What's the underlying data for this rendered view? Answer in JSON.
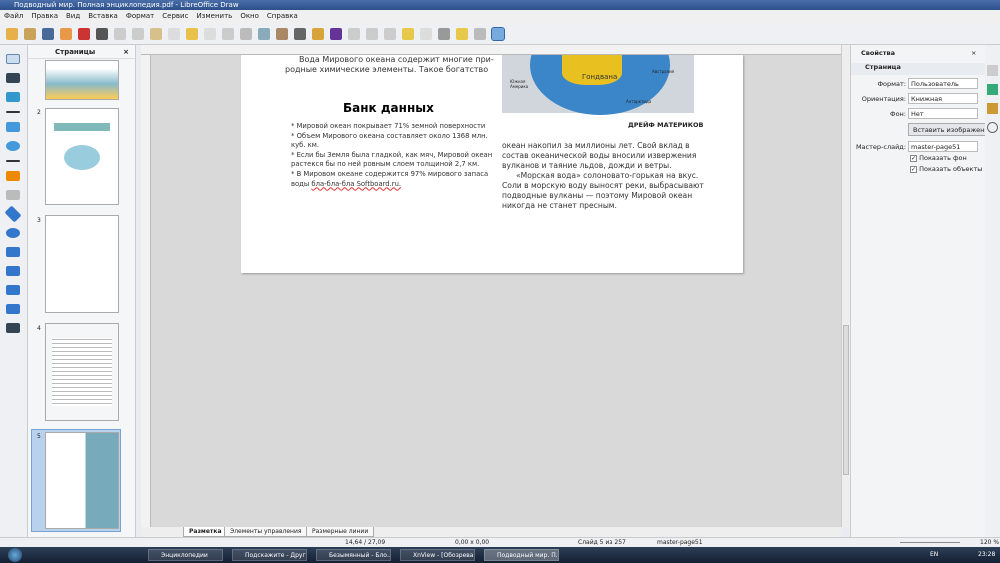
{
  "window": {
    "title": "Подводный мир. Полная энциклопедия.pdf - LibreOffice Draw"
  },
  "menu": [
    "Файл",
    "Правка",
    "Вид",
    "Вставка",
    "Формат",
    "Сервис",
    "Изменить",
    "Окно",
    "Справка"
  ],
  "pages_panel": {
    "title": "Страницы",
    "close": "×",
    "numbers": [
      "2",
      "3",
      "4",
      "5"
    ]
  },
  "page": {
    "top_line1": "Вода Мирового океана содержит многие при-",
    "top_line2": "родные химические элементы. Такое богатство",
    "map_labels": {
      "gondwana": "Гондвана",
      "south_america": "Южная Америка",
      "australia": "Австралия",
      "antarctica": "Антарктида"
    },
    "map_caption": "ДРЕЙФ МАТЕРИКОВ",
    "heading": "Банк данных",
    "bullets": [
      "Мировой океан покрывает 71% земной поверхности",
      "Объем Мирового океана составляет около 1368 млн. куб. км.",
      "Если бы Земля была гладкой, как мяч, Мировой океан растекся бы по ней ровным слоем толщиной 2,7 км.",
      "В Мировом океане содержится 97% мирового запаса воды "
    ],
    "bullet_link": "бла-бла-бла Softboard.ru.",
    "right_text": [
      "океан накопил за миллионы лет. Свой вклад в",
      "состав океанической воды вносили извержения",
      "вулканов и таяние льдов, дожди и ветры.",
      "«Морская вода» солоновато-горькая на вкус.",
      "Соли в морскую воду выносят реки, выбрасывают",
      "подводные вулканы — поэтому Мировой океан",
      "никогда не станет пресным."
    ]
  },
  "sidebar": {
    "title": "Свойства",
    "close": "×",
    "section": "Страница",
    "format_label": "Формат:",
    "format_value": "Пользователь",
    "orientation_label": "Ориентация:",
    "orientation_value": "Книжная",
    "background_label": "Фон:",
    "background_value": "Нет",
    "insert_image": "Вставить изображение",
    "master_label": "Мастер-слайд:",
    "master_value": "master-page51",
    "show_bg": "Показать фон",
    "show_objects": "Показать объекты"
  },
  "tabs": [
    "Разметка",
    "Элементы управления",
    "Размерные линии"
  ],
  "status": {
    "position": "14,64 / 27,09",
    "size": "0,00 x 0,00",
    "slide": "Слайд 5 из 257",
    "master": "master-page51",
    "zoom": "120 %"
  },
  "taskbar": {
    "tasks": [
      "Энциклопедии",
      "Подскажите - Друг...",
      "Безымянный - Бло...",
      "XnView - [Обозрева...",
      "Подводный мир. П..."
    ],
    "lang": "EN",
    "time": "23:28"
  }
}
